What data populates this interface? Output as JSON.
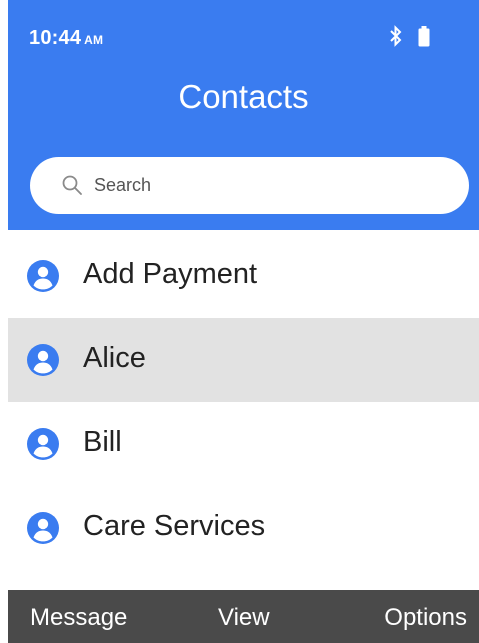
{
  "status_bar": {
    "time": "10:44",
    "ampm": "AM",
    "icons": [
      "bluetooth-icon",
      "battery-icon"
    ]
  },
  "header": {
    "title": "Contacts"
  },
  "search": {
    "placeholder": "Search",
    "icon": "search-icon"
  },
  "contacts": [
    {
      "name": "Add Payment",
      "icon": "contact-icon",
      "selected": false
    },
    {
      "name": "Alice",
      "icon": "contact-icon",
      "selected": true
    },
    {
      "name": "Bill",
      "icon": "contact-icon",
      "selected": false
    },
    {
      "name": "Care Services",
      "icon": "contact-icon",
      "selected": false
    }
  ],
  "softkeys": {
    "left": "Message",
    "center": "View",
    "right": "Options"
  },
  "colors": {
    "header_bg": "#3a7cf0",
    "accent": "#3a7cf0",
    "selected_row": "#e2e2e2",
    "softkey_bar": "#4a4a4a"
  }
}
